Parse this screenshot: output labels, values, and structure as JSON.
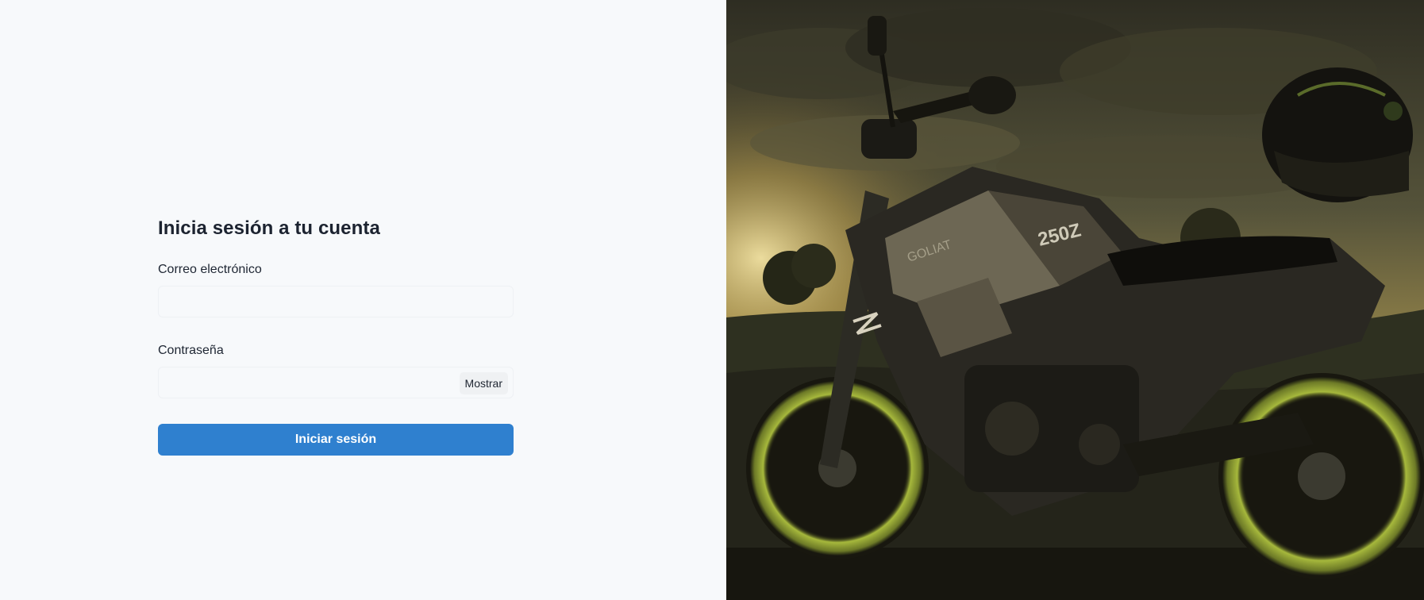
{
  "login": {
    "title": "Inicia sesión a tu cuenta",
    "email_label": "Correo electrónico",
    "email_value": "",
    "password_label": "Contraseña",
    "password_value": "",
    "show_password_label": "Mostrar",
    "submit_label": "Iniciar sesión"
  },
  "hero_image": {
    "subject": "motorcycle with helmet at dusk",
    "badge_text": "250Z",
    "brand_text": "GOLIAT"
  },
  "colors": {
    "background": "#f7f9fb",
    "primary_button": "#2f80cf",
    "text": "#1d2430"
  }
}
